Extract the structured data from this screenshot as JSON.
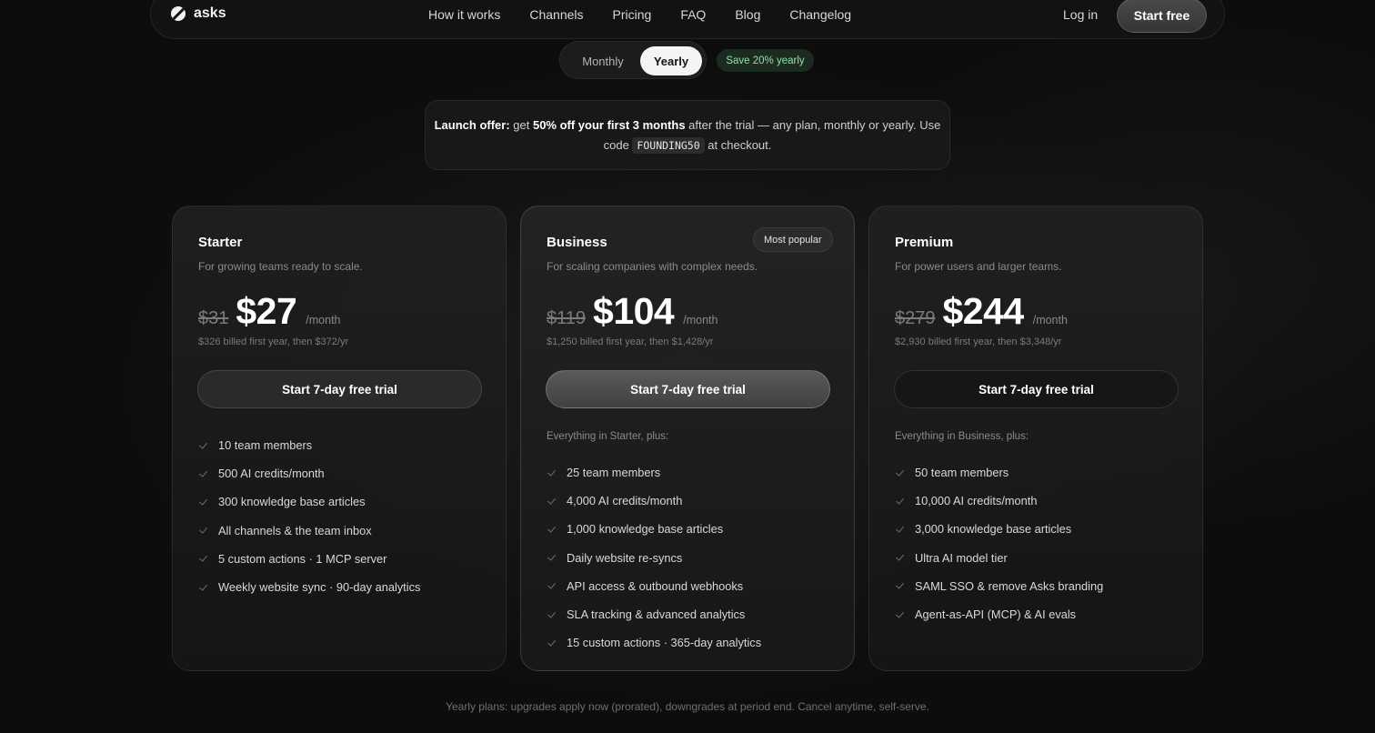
{
  "nav": {
    "brand": "asks",
    "links": [
      "How it works",
      "Channels",
      "Pricing",
      "FAQ",
      "Blog",
      "Changelog"
    ],
    "login": "Log in",
    "start": "Start free"
  },
  "billing": {
    "monthly": "Monthly",
    "yearly": "Yearly",
    "selected": "Yearly",
    "save_badge": "Save 20% yearly"
  },
  "offer": {
    "label": "Launch offer:",
    "text1": " get ",
    "highlight": "50% off your first 3 months",
    "text2": " after the trial — any plan, monthly or yearly. Use code ",
    "code": "FOUNDING50",
    "text3": " at checkout."
  },
  "plans": [
    {
      "name": "Starter",
      "description": "For growing teams ready to scale.",
      "old_price": "$31",
      "price": "$27",
      "unit": "/month",
      "billed": "$326 billed first year, then $372/yr",
      "cta": "Start 7-day free trial",
      "features": [
        "10 team members",
        "500 AI credits/month",
        "300 knowledge base articles",
        "All channels & the team inbox",
        "5 custom actions · 1 MCP server",
        "Weekly website sync · 90-day analytics"
      ]
    },
    {
      "name": "Business",
      "badge": "Most popular",
      "description": "For scaling companies with complex needs.",
      "old_price": "$119",
      "price": "$104",
      "unit": "/month",
      "billed": "$1,250 billed first year, then $1,428/yr",
      "cta": "Start 7-day free trial",
      "everything": "Everything in Starter, plus:",
      "features": [
        "25 team members",
        "4,000 AI credits/month",
        "1,000 knowledge base articles",
        "Daily website re-syncs",
        "API access & outbound webhooks",
        "SLA tracking & advanced analytics",
        "15 custom actions · 365-day analytics"
      ]
    },
    {
      "name": "Premium",
      "description": "For power users and larger teams.",
      "old_price": "$279",
      "price": "$244",
      "unit": "/month",
      "billed": "$2,930 billed first year, then $3,348/yr",
      "cta": "Start 7-day free trial",
      "everything": "Everything in Business, plus:",
      "features": [
        "50 team members",
        "10,000 AI credits/month",
        "3,000 knowledge base articles",
        "Ultra AI model tier",
        "SAML SSO & remove Asks branding",
        "Agent-as-API (MCP) & AI evals"
      ]
    }
  ],
  "footnote": "Yearly plans: upgrades apply now (prorated), downgrades at period end. Cancel anytime, self-serve.",
  "icons": {
    "check": "check-icon",
    "logo": "asks-logo-icon"
  }
}
